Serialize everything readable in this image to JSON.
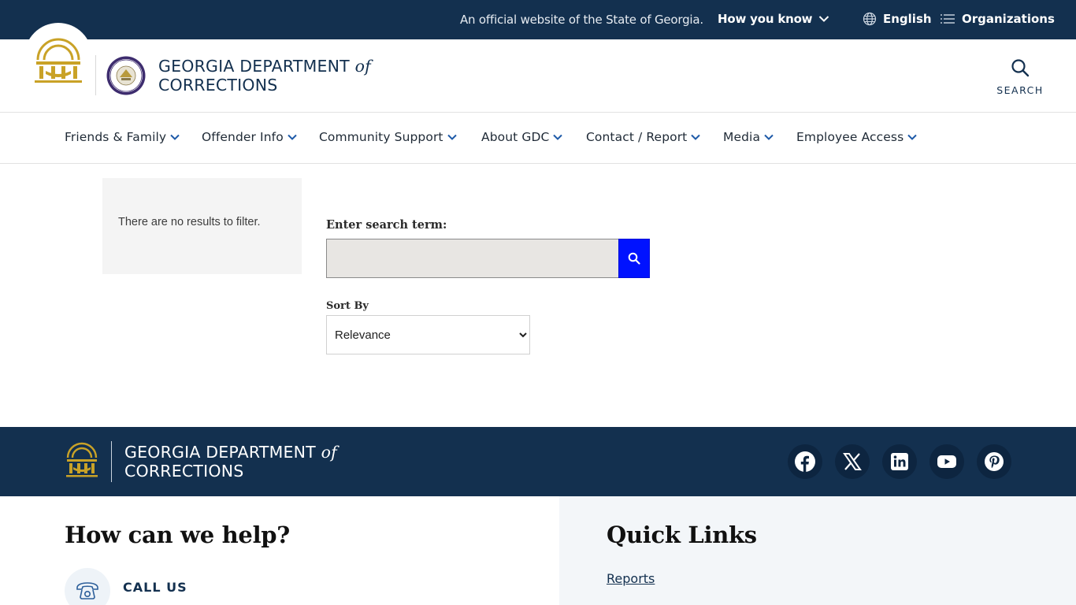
{
  "banner": {
    "official_text": "An official website of the State of Georgia.",
    "how_you_know": "How you know",
    "language": "English",
    "organizations": "Organizations"
  },
  "header": {
    "agency_line1": "GEORGIA DEPARTMENT",
    "agency_of": "of",
    "agency_line2": "CORRECTIONS",
    "search_label": "SEARCH"
  },
  "nav": {
    "items": [
      {
        "label": "Friends & Family"
      },
      {
        "label": "Offender Info"
      },
      {
        "label": "Community Support"
      },
      {
        "label": "About GDC"
      },
      {
        "label": "Contact / Report"
      },
      {
        "label": "Media"
      },
      {
        "label": "Employee Access"
      }
    ]
  },
  "filter": {
    "message": "There are no results to filter."
  },
  "search": {
    "label": "Enter search term:",
    "value": "",
    "placeholder": ""
  },
  "sort": {
    "label": "Sort By",
    "selected": "Relevance"
  },
  "footer": {
    "agency_line1": "GEORGIA DEPARTMENT",
    "agency_of": "of",
    "agency_line2": "CORRECTIONS",
    "social": [
      "facebook-icon",
      "x-icon",
      "linkedin-icon",
      "youtube-icon",
      "pinterest-icon"
    ],
    "help_title": "How can we help?",
    "call_us": "CALL US",
    "quick_links_title": "Quick Links",
    "quick_links": [
      "Reports"
    ]
  },
  "colors": {
    "navy": "#13304f",
    "gold": "#c9a227",
    "search_button": "#0012ff"
  }
}
